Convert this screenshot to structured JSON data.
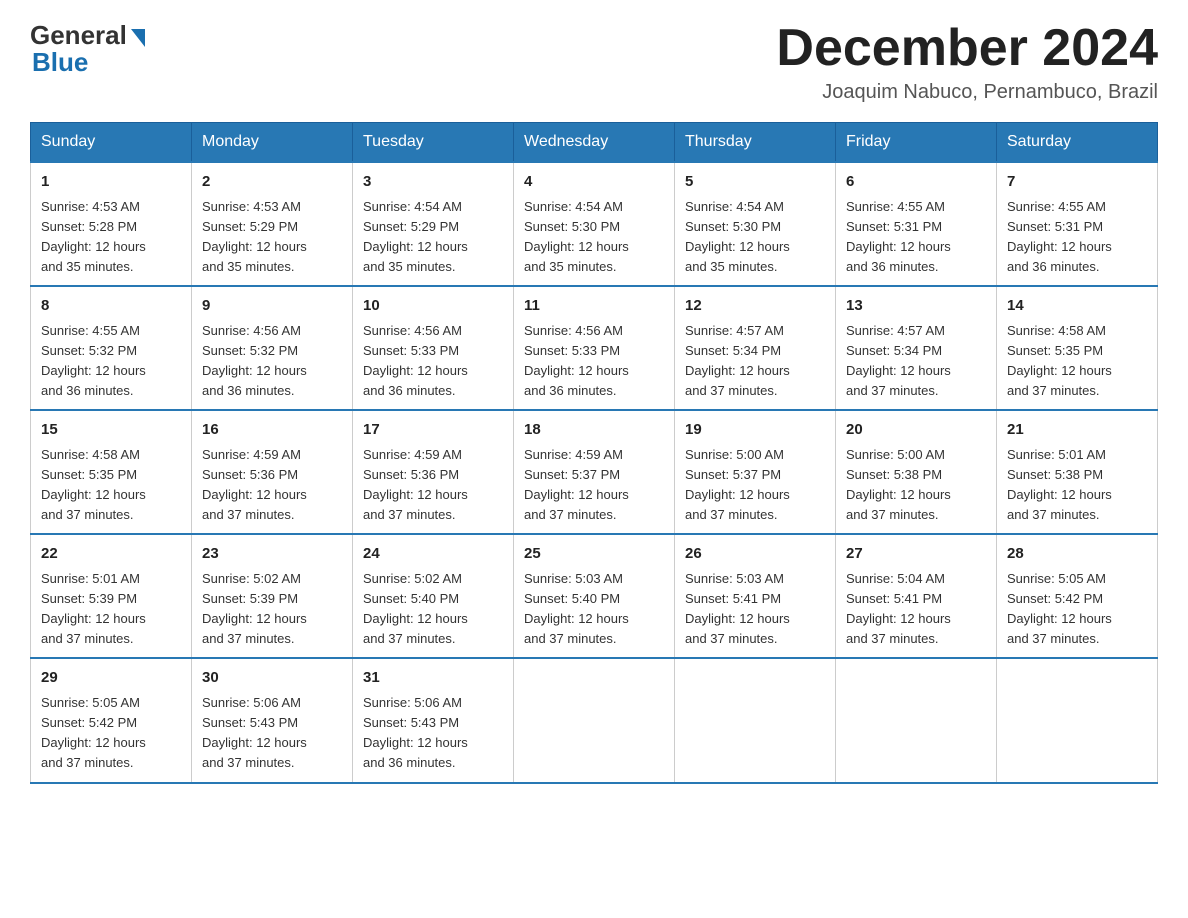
{
  "header": {
    "logo_general": "General",
    "logo_blue": "Blue",
    "month_title": "December 2024",
    "location": "Joaquim Nabuco, Pernambuco, Brazil"
  },
  "weekdays": [
    "Sunday",
    "Monday",
    "Tuesday",
    "Wednesday",
    "Thursday",
    "Friday",
    "Saturday"
  ],
  "weeks": [
    [
      {
        "day": "1",
        "sunrise": "4:53 AM",
        "sunset": "5:28 PM",
        "daylight": "12 hours and 35 minutes."
      },
      {
        "day": "2",
        "sunrise": "4:53 AM",
        "sunset": "5:29 PM",
        "daylight": "12 hours and 35 minutes."
      },
      {
        "day": "3",
        "sunrise": "4:54 AM",
        "sunset": "5:29 PM",
        "daylight": "12 hours and 35 minutes."
      },
      {
        "day": "4",
        "sunrise": "4:54 AM",
        "sunset": "5:30 PM",
        "daylight": "12 hours and 35 minutes."
      },
      {
        "day": "5",
        "sunrise": "4:54 AM",
        "sunset": "5:30 PM",
        "daylight": "12 hours and 35 minutes."
      },
      {
        "day": "6",
        "sunrise": "4:55 AM",
        "sunset": "5:31 PM",
        "daylight": "12 hours and 36 minutes."
      },
      {
        "day": "7",
        "sunrise": "4:55 AM",
        "sunset": "5:31 PM",
        "daylight": "12 hours and 36 minutes."
      }
    ],
    [
      {
        "day": "8",
        "sunrise": "4:55 AM",
        "sunset": "5:32 PM",
        "daylight": "12 hours and 36 minutes."
      },
      {
        "day": "9",
        "sunrise": "4:56 AM",
        "sunset": "5:32 PM",
        "daylight": "12 hours and 36 minutes."
      },
      {
        "day": "10",
        "sunrise": "4:56 AM",
        "sunset": "5:33 PM",
        "daylight": "12 hours and 36 minutes."
      },
      {
        "day": "11",
        "sunrise": "4:56 AM",
        "sunset": "5:33 PM",
        "daylight": "12 hours and 36 minutes."
      },
      {
        "day": "12",
        "sunrise": "4:57 AM",
        "sunset": "5:34 PM",
        "daylight": "12 hours and 37 minutes."
      },
      {
        "day": "13",
        "sunrise": "4:57 AM",
        "sunset": "5:34 PM",
        "daylight": "12 hours and 37 minutes."
      },
      {
        "day": "14",
        "sunrise": "4:58 AM",
        "sunset": "5:35 PM",
        "daylight": "12 hours and 37 minutes."
      }
    ],
    [
      {
        "day": "15",
        "sunrise": "4:58 AM",
        "sunset": "5:35 PM",
        "daylight": "12 hours and 37 minutes."
      },
      {
        "day": "16",
        "sunrise": "4:59 AM",
        "sunset": "5:36 PM",
        "daylight": "12 hours and 37 minutes."
      },
      {
        "day": "17",
        "sunrise": "4:59 AM",
        "sunset": "5:36 PM",
        "daylight": "12 hours and 37 minutes."
      },
      {
        "day": "18",
        "sunrise": "4:59 AM",
        "sunset": "5:37 PM",
        "daylight": "12 hours and 37 minutes."
      },
      {
        "day": "19",
        "sunrise": "5:00 AM",
        "sunset": "5:37 PM",
        "daylight": "12 hours and 37 minutes."
      },
      {
        "day": "20",
        "sunrise": "5:00 AM",
        "sunset": "5:38 PM",
        "daylight": "12 hours and 37 minutes."
      },
      {
        "day": "21",
        "sunrise": "5:01 AM",
        "sunset": "5:38 PM",
        "daylight": "12 hours and 37 minutes."
      }
    ],
    [
      {
        "day": "22",
        "sunrise": "5:01 AM",
        "sunset": "5:39 PM",
        "daylight": "12 hours and 37 minutes."
      },
      {
        "day": "23",
        "sunrise": "5:02 AM",
        "sunset": "5:39 PM",
        "daylight": "12 hours and 37 minutes."
      },
      {
        "day": "24",
        "sunrise": "5:02 AM",
        "sunset": "5:40 PM",
        "daylight": "12 hours and 37 minutes."
      },
      {
        "day": "25",
        "sunrise": "5:03 AM",
        "sunset": "5:40 PM",
        "daylight": "12 hours and 37 minutes."
      },
      {
        "day": "26",
        "sunrise": "5:03 AM",
        "sunset": "5:41 PM",
        "daylight": "12 hours and 37 minutes."
      },
      {
        "day": "27",
        "sunrise": "5:04 AM",
        "sunset": "5:41 PM",
        "daylight": "12 hours and 37 minutes."
      },
      {
        "day": "28",
        "sunrise": "5:05 AM",
        "sunset": "5:42 PM",
        "daylight": "12 hours and 37 minutes."
      }
    ],
    [
      {
        "day": "29",
        "sunrise": "5:05 AM",
        "sunset": "5:42 PM",
        "daylight": "12 hours and 37 minutes."
      },
      {
        "day": "30",
        "sunrise": "5:06 AM",
        "sunset": "5:43 PM",
        "daylight": "12 hours and 37 minutes."
      },
      {
        "day": "31",
        "sunrise": "5:06 AM",
        "sunset": "5:43 PM",
        "daylight": "12 hours and 36 minutes."
      },
      null,
      null,
      null,
      null
    ]
  ],
  "labels": {
    "sunrise_prefix": "Sunrise: ",
    "sunset_prefix": "Sunset: ",
    "daylight_prefix": "Daylight: "
  }
}
